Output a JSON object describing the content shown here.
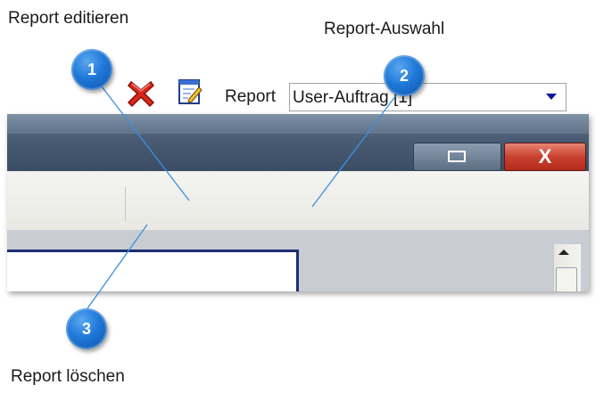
{
  "callouts": [
    {
      "number": "1",
      "label": "Report editieren"
    },
    {
      "number": "2",
      "label": "Report-Auswahl"
    },
    {
      "number": "3",
      "label": "Report löschen"
    }
  ],
  "window": {
    "close_glyph": "X"
  },
  "toolbar": {
    "report_label": "Report",
    "report_select_value": "User-Auftrag [1]",
    "delete_icon": "red-x-icon",
    "edit_icon": "notepad-pencil-icon"
  },
  "colors": {
    "callout_blue": "#1f78d8",
    "callout_line": "#3d8fe0",
    "delete_red": "#d8261a",
    "close_red": "#c9412f"
  }
}
